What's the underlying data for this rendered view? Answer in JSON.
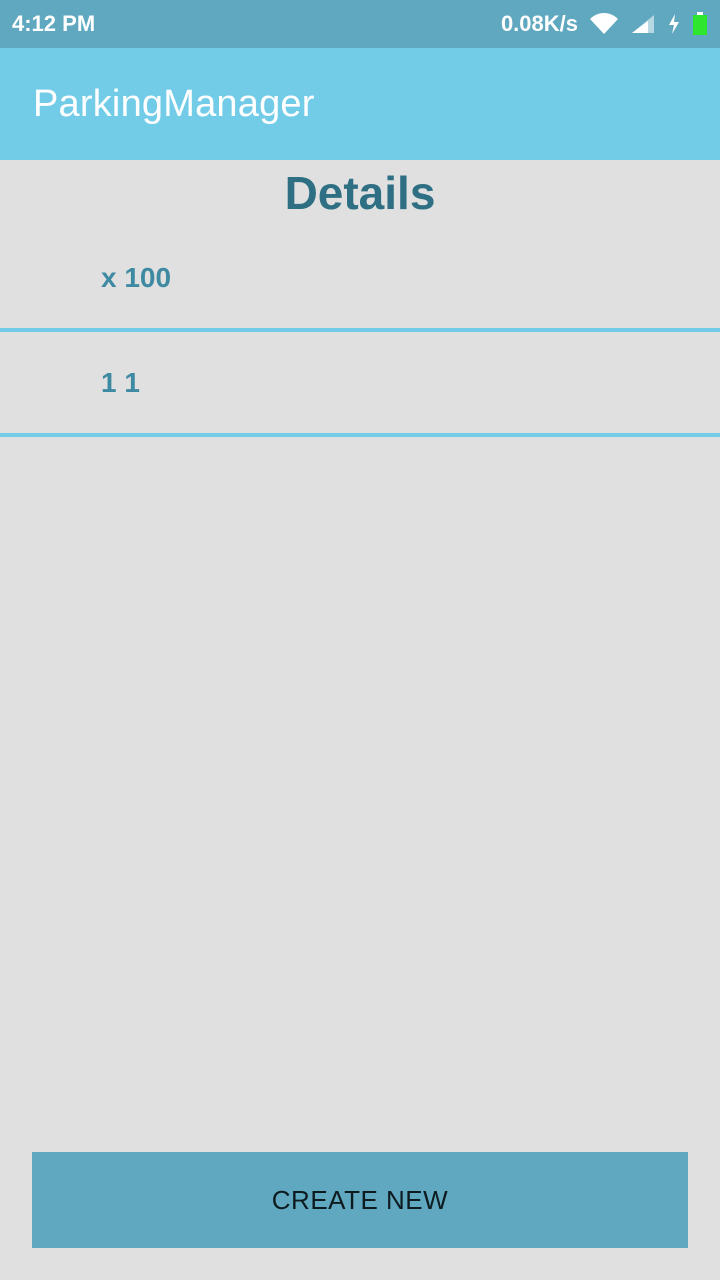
{
  "status_bar": {
    "time": "4:12 PM",
    "network_speed": "0.08K/s",
    "icons": [
      "wifi-icon",
      "signal-icon",
      "charging-icon",
      "battery-icon"
    ],
    "battery_color": "#2ee62e"
  },
  "app_bar": {
    "title": "ParkingManager",
    "color": "#72cce8"
  },
  "main": {
    "heading": "Details",
    "items": [
      {
        "label": "x 100"
      },
      {
        "label": "1 1"
      }
    ]
  },
  "actions": {
    "create_label": "CREATE NEW"
  },
  "colors": {
    "accent": "#72cce8",
    "status_bar": "#5fa8bf",
    "background": "#e0e0e0",
    "heading_text": "#2f6f84",
    "item_text": "#3f8aa3"
  }
}
